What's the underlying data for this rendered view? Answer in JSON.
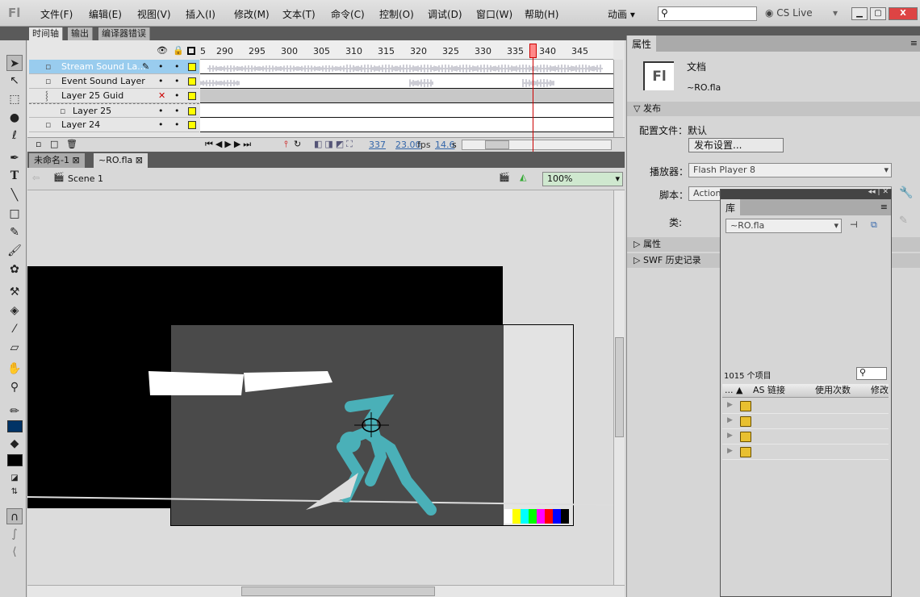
{
  "app": {
    "logo": "Fl",
    "menus": [
      "文件(F)",
      "编辑(E)",
      "视图(V)",
      "插入(I)",
      "修改(M)",
      "文本(T)",
      "命令(C)",
      "控制(O)",
      "调试(D)",
      "窗口(W)",
      "帮助(H)"
    ],
    "workspace": "动画",
    "search_placeholder": "",
    "cs_live": "CS Live"
  },
  "panel_tabs": [
    "时间轴",
    "输出",
    "编译器错误"
  ],
  "timeline": {
    "ruler": [
      "5",
      "290",
      "295",
      "300",
      "305",
      "310",
      "315",
      "320",
      "325",
      "330",
      "335",
      "340",
      "345"
    ],
    "layers": [
      {
        "name": "Stream Sound La...",
        "selected": true,
        "type": "normal"
      },
      {
        "name": "Event Sound Layer",
        "type": "normal"
      },
      {
        "name": "Layer 25 Guid",
        "type": "guide",
        "hidden": true
      },
      {
        "name": "Layer 25",
        "type": "guided"
      },
      {
        "name": "Layer 24",
        "type": "normal"
      }
    ],
    "current_frame": "337",
    "fps": "23.00",
    "fps_unit": "fps",
    "time": "14.6",
    "time_unit": "s",
    "playhead_frame": 337
  },
  "doc_tabs": [
    "未命名-1",
    "~RO.fla"
  ],
  "editbar": {
    "scene": "Scene 1",
    "zoom": "100%"
  },
  "properties": {
    "title": "属性",
    "doc_icon": "Fl",
    "doc_type": "文档",
    "doc_name": "~RO.fla",
    "publish_section": "发布",
    "profile_label": "配置文件：",
    "profile_value": "默认",
    "publish_settings_btn": "发布设置...",
    "player_label": "播放器：",
    "player_value": "Flash Player 8",
    "script_label": "脚本：",
    "script_value": "Action",
    "class_label": "类:",
    "section_props": "属性",
    "section_swf": "SWF 历史记录"
  },
  "library": {
    "title": "库",
    "doc_select": "~RO.fla",
    "count": "1015 个项目",
    "columns": [
      "...",
      "AS 链接",
      "使用次数",
      "修改"
    ],
    "folders": 4
  },
  "colors": {
    "accent_selection": "#99ccee",
    "stroke_color": "#000000",
    "fill_color": "#003366",
    "character": "#4ab0b8"
  }
}
